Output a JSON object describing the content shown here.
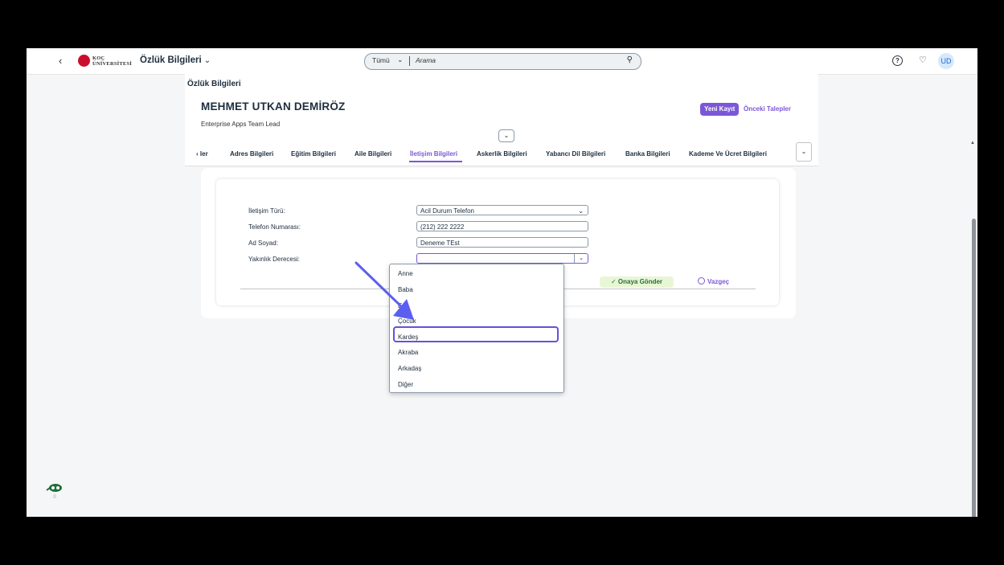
{
  "shell": {
    "back_icon": "chevron-left-icon",
    "logo_line1": "KOÇ",
    "logo_line2": "ÜNİVERSİTESİ",
    "app_title": "Özlük Bilgileri",
    "search_scope": "Tümü",
    "search_placeholder": "Arama",
    "avatar_initials": "UD"
  },
  "page": {
    "title": "Özlük Bilgileri",
    "person_name": "MEHMET UTKAN DEMİRÖZ",
    "person_role": "Enterprise Apps Team Lead",
    "new_record_label": "Yeni Kayıt",
    "previous_requests_label": "Önceki Talepler"
  },
  "tabs": [
    {
      "label": "ler"
    },
    {
      "label": "Adres Bilgileri"
    },
    {
      "label": "Eğitim Bilgileri"
    },
    {
      "label": "Aile Bilgileri"
    },
    {
      "label": "İletişim Bilgileri"
    },
    {
      "label": "Askerlik Bilgileri"
    },
    {
      "label": "Yabancı Dil Bilgileri"
    },
    {
      "label": "Banka Bilgileri"
    },
    {
      "label": "Kademe Ve Ücret Bilgileri"
    }
  ],
  "active_tab": "İletişim Bilgileri",
  "form": {
    "contact_type_label": "İletişim Türü:",
    "contact_type_value": "Acil Durum Telefon",
    "phone_label": "Telefon Numarası:",
    "phone_value": "(212) 222 2222",
    "name_label": "Ad Soyad:",
    "name_value": "Deneme TEst",
    "relation_label": "Yakınlık Derecesi:",
    "relation_value": "",
    "send_label": "Onaya Gönder",
    "cancel_label": "Vazgeç"
  },
  "relation_options": [
    "Anne",
    "Baba",
    "Eş",
    "Çocuk",
    "Kardeş",
    "Akraba",
    "Arkadaş",
    "Diğer"
  ],
  "highlighted_option": "Kardeş",
  "colors": {
    "accent": "#7b57d8",
    "send_bg": "#e9f6d6",
    "send_text": "#256f3a",
    "annotation_arrow": "#5b5ff0"
  }
}
